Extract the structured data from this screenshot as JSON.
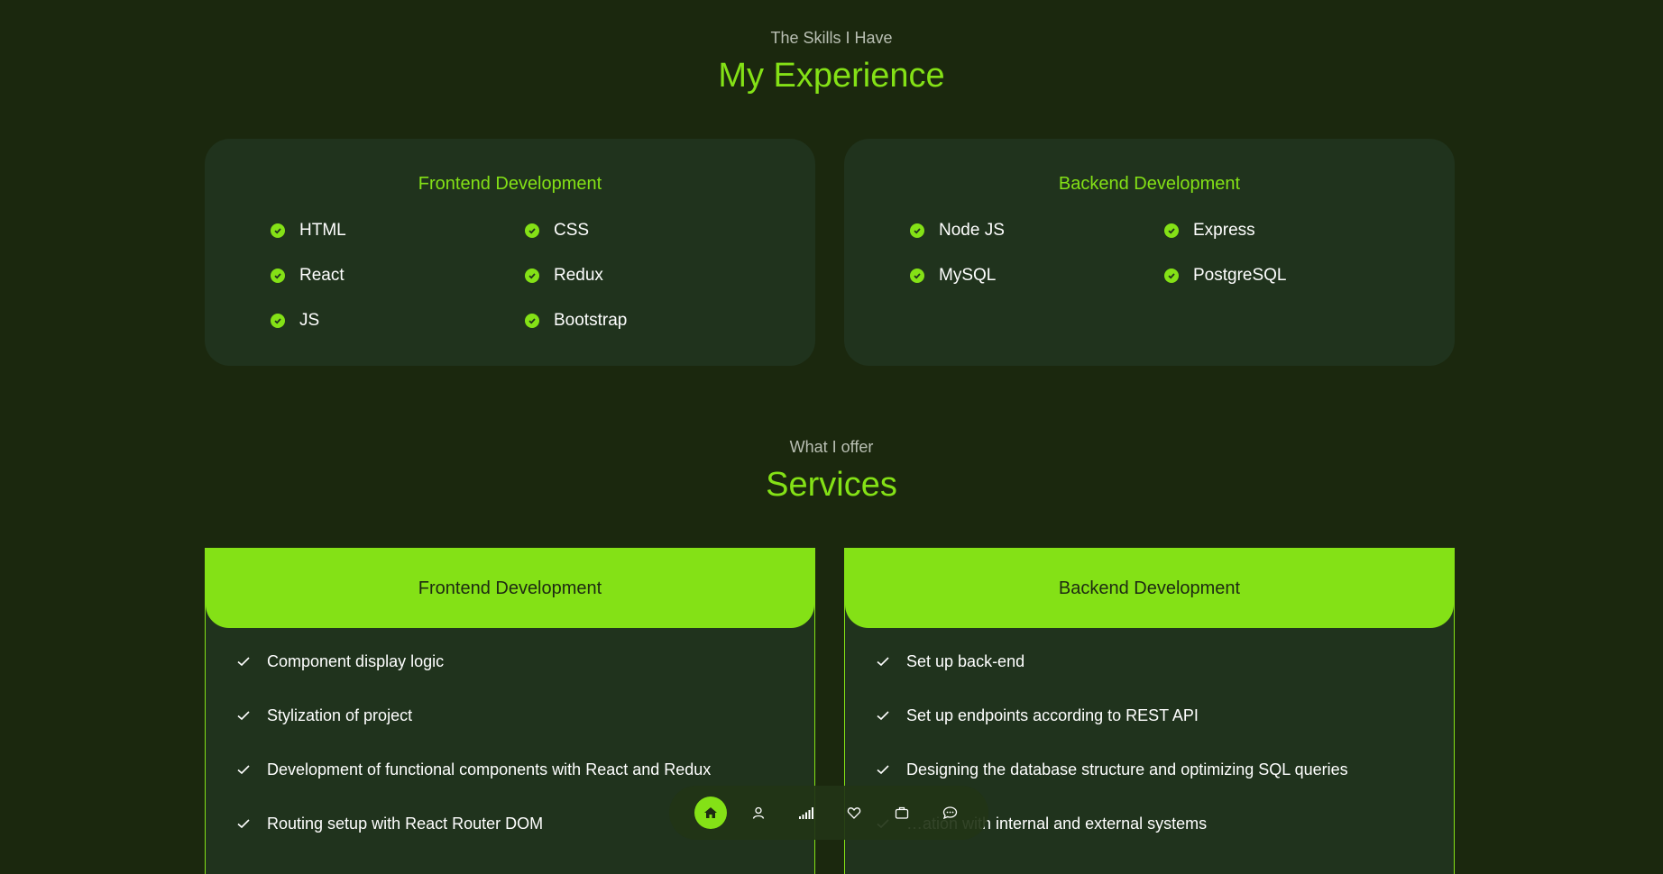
{
  "experience": {
    "subtitle": "The Skills I Have",
    "title": "My Experience",
    "cards": [
      {
        "title": "Frontend Development",
        "skills": [
          "HTML",
          "CSS",
          "React",
          "Redux",
          "JS",
          "Bootstrap"
        ]
      },
      {
        "title": "Backend Development",
        "skills": [
          "Node JS",
          "Express",
          "MySQL",
          "PostgreSQL"
        ]
      }
    ]
  },
  "services": {
    "subtitle": "What I offer",
    "title": "Services",
    "cards": [
      {
        "title": "Frontend Development",
        "items": [
          "Component display logic",
          "Stylization of project",
          "Development of functional components with React and Redux",
          "Routing setup with React Router DOM"
        ]
      },
      {
        "title": "Backend Development",
        "items": [
          "Set up back-end",
          "Set up endpoints according to REST API",
          "Designing the database structure and optimizing SQL queries",
          "…ation with internal and external systems"
        ]
      }
    ]
  },
  "nav": {
    "items": [
      {
        "icon": "home-icon",
        "active": true
      },
      {
        "icon": "user-icon",
        "active": false
      },
      {
        "icon": "signal-bars-icon",
        "active": false
      },
      {
        "icon": "heart-icon",
        "active": false
      },
      {
        "icon": "briefcase-icon",
        "active": false
      },
      {
        "icon": "chat-icon",
        "active": false
      }
    ]
  },
  "colors": {
    "background": "#1b280e",
    "card": "#20331d",
    "accent": "#84e116",
    "muted": "#b9bfb3"
  }
}
